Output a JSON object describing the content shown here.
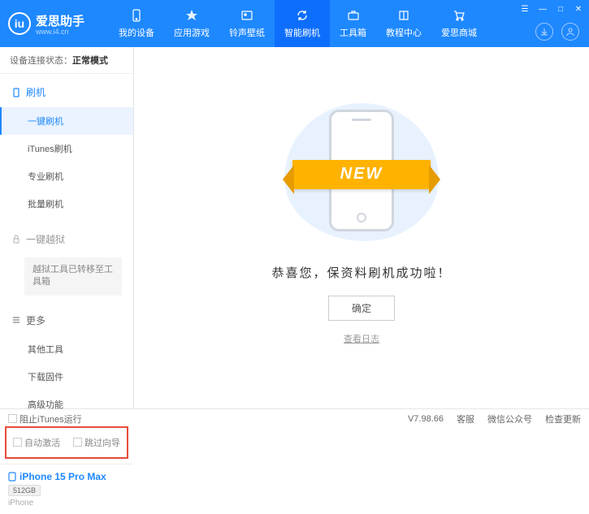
{
  "header": {
    "appName": "爱思助手",
    "url": "www.i4.cn",
    "nav": [
      {
        "label": "我的设备"
      },
      {
        "label": "应用游戏"
      },
      {
        "label": "铃声壁纸"
      },
      {
        "label": "智能刷机"
      },
      {
        "label": "工具箱"
      },
      {
        "label": "教程中心"
      },
      {
        "label": "爱思商城"
      }
    ]
  },
  "sidebar": {
    "statusLabel": "设备连接状态：",
    "statusValue": "正常模式",
    "flashHeader": "刷机",
    "flashItems": [
      "一键刷机",
      "iTunes刷机",
      "专业刷机",
      "批量刷机"
    ],
    "jailbreakHeader": "一键越狱",
    "jailbreakNote": "越狱工具已转移至工具箱",
    "moreHeader": "更多",
    "moreItems": [
      "其他工具",
      "下载固件",
      "高级功能"
    ],
    "cb1": "自动激活",
    "cb2": "跳过向导",
    "deviceName": "iPhone 15 Pro Max",
    "deviceStorage": "512GB",
    "deviceType": "iPhone"
  },
  "main": {
    "ribbon": "NEW",
    "successMsg": "恭喜您，保资料刷机成功啦！",
    "okBtn": "确定",
    "logLink": "查看日志"
  },
  "footer": {
    "blockItunes": "阻止iTunes运行",
    "version": "V7.98.66",
    "links": [
      "客服",
      "微信公众号",
      "检查更新"
    ]
  }
}
